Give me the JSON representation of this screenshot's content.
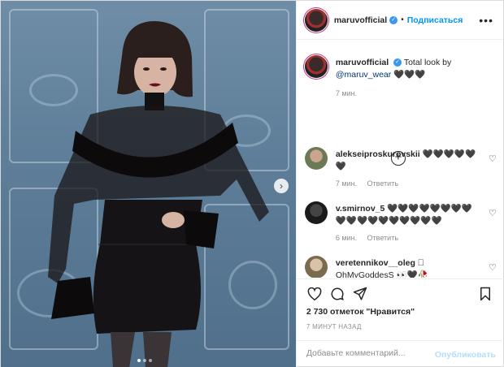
{
  "header": {
    "username": "maruvofficial",
    "separator": "•",
    "follow_label": "Подписаться",
    "more_label": "•••"
  },
  "caption": {
    "username": "maruvofficial",
    "text": "Total look by",
    "mention": "@maruv_wear",
    "emoji": "🖤🖤🖤",
    "time": "7 мин."
  },
  "load_more_label": "+",
  "comments": [
    {
      "username": "alekseiproskurovskii",
      "text": "🖤🖤🖤🖤🖤 🖤",
      "time": "7 мин.",
      "reply": "Ответить"
    },
    {
      "username": "v.smirnov_5",
      "text": "🖤🖤🖤🖤🖤🖤🖤🖤 🖤🖤🖤🖤🖤🖤🖤🖤🖤🖤",
      "time": "6 мин.",
      "reply": "Ответить"
    },
    {
      "username": "veretennikov__oleg",
      "glyph": "􀀀",
      "text": "OhMyGoddesS 👀🖤🥀"
    }
  ],
  "likes_text": "2 730 отметок \"Нравится\"",
  "posted_ago": "7 МИНУТ НАЗАД",
  "composer": {
    "placeholder": "Добавьте комментарий...",
    "publish_label": "Опубликовать"
  },
  "carousel": {
    "slides": 3,
    "active_slide": 1
  },
  "colors": {
    "link": "#0095f6",
    "publish_disabled": "#b2dffc",
    "muted": "#8e8e8e",
    "verified": "#3897f0"
  },
  "icons": [
    "verified-badge-icon",
    "more-icon",
    "heart-icon",
    "comment-icon",
    "share-icon",
    "bookmark-icon",
    "next-arrow-icon",
    "load-more-icon"
  ]
}
